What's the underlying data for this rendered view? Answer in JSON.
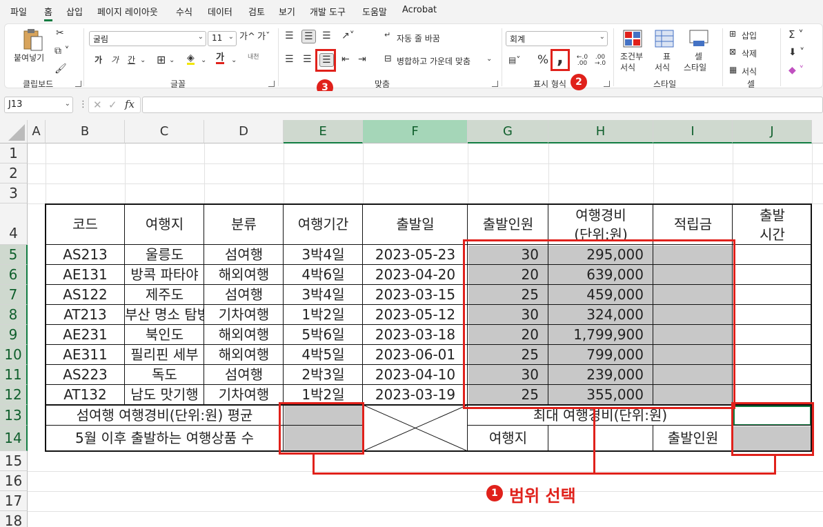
{
  "tabs": [
    "파일",
    "홈",
    "삽입",
    "페이지 레이아웃",
    "수식",
    "데이터",
    "검토",
    "보기",
    "개발 도구",
    "도움말",
    "Acrobat"
  ],
  "active_tab": "홈",
  "ribbon": {
    "clipboard": {
      "paste_label": "붙여넣기",
      "group": "클립보드"
    },
    "font": {
      "name": "굴림",
      "size": "11",
      "group": "글꼴",
      "grow": "가^",
      "shrink": "가ˇ",
      "bold": "가",
      "italic": "가",
      "underline": "간",
      "fontcolor": "가",
      "phonetic": "내천"
    },
    "align": {
      "wrap": "자동 줄 바꿈",
      "merge": "병합하고 가운데 맞춤",
      "group": "맞춤"
    },
    "number": {
      "format": "회계",
      "percent": "%",
      "comma": ",",
      "inc": "←.0 .00",
      "dec": ".00 →.0",
      "group": "표시 형식"
    },
    "styles": {
      "cond": "조건부 서식",
      "cond_l1": "조건부",
      "cond_l2": "서식",
      "table_l1": "표",
      "table_l2": "서식",
      "cell_l1": "셀",
      "cell_l2": "스타일",
      "group": "스타일"
    },
    "cells": {
      "insert": "삽입",
      "delete": "삭제",
      "format": "서식",
      "group": "셀"
    }
  },
  "badges": {
    "one": "1",
    "two": "2",
    "three": "3",
    "caption": "범위 선택"
  },
  "name_box": "J13",
  "fx": "fx",
  "columns": [
    "A",
    "B",
    "C",
    "D",
    "E",
    "F",
    "G",
    "H",
    "I",
    "J"
  ],
  "rows": [
    "1",
    "2",
    "3",
    "4",
    "5",
    "6",
    "7",
    "8",
    "9",
    "10",
    "11",
    "12",
    "13",
    "14",
    "15",
    "16",
    "17",
    "18"
  ],
  "header": {
    "code": "코드",
    "dest": "여행지",
    "cat": "분류",
    "period": "여행기간",
    "date": "출발일",
    "people": "출발인원",
    "cost1": "여행경비",
    "cost2": "(단위:원)",
    "saving": "적립금",
    "time1": "출발",
    "time2": "시간"
  },
  "table_rows": [
    {
      "code": "AS213",
      "dest": "울릉도",
      "cat": "섬여행",
      "period": "3박4일",
      "date": "2023-05-23",
      "people": "30",
      "cost": "295,000"
    },
    {
      "code": "AE131",
      "dest": "방콕 파타야",
      "cat": "해외여행",
      "period": "4박6일",
      "date": "2023-04-20",
      "people": "20",
      "cost": "639,000"
    },
    {
      "code": "AS122",
      "dest": "제주도",
      "cat": "섬여행",
      "period": "3박4일",
      "date": "2023-03-15",
      "people": "25",
      "cost": "459,000"
    },
    {
      "code": "AT213",
      "dest": "부산 명소 탐방",
      "cat": "기차여행",
      "period": "1박2일",
      "date": "2023-05-12",
      "people": "30",
      "cost": "324,000"
    },
    {
      "code": "AE231",
      "dest": "북인도",
      "cat": "해외여행",
      "period": "5박6일",
      "date": "2023-03-18",
      "people": "20",
      "cost": "1,799,900"
    },
    {
      "code": "AE311",
      "dest": "필리핀 세부",
      "cat": "해외여행",
      "period": "4박5일",
      "date": "2023-06-01",
      "people": "25",
      "cost": "799,000"
    },
    {
      "code": "AS223",
      "dest": "독도",
      "cat": "섬여행",
      "period": "2박3일",
      "date": "2023-04-10",
      "people": "30",
      "cost": "239,000"
    },
    {
      "code": "AT132",
      "dest": "남도 맛기행",
      "cat": "기차여행",
      "period": "1박2일",
      "date": "2023-03-19",
      "people": "25",
      "cost": "355,000"
    }
  ],
  "footer": {
    "avg_label": "섬여행 여행경비(단위:원) 평균",
    "count_label": "5월 이후 출발하는 여행상품 수",
    "max_label": "최대 여행경비(단위:원)",
    "dest_label": "여행지",
    "people_label": "출발인원"
  },
  "colors": {
    "accent": "#107c41",
    "highlight": "#e0211b",
    "gray_cell": "#c8c8c8"
  }
}
